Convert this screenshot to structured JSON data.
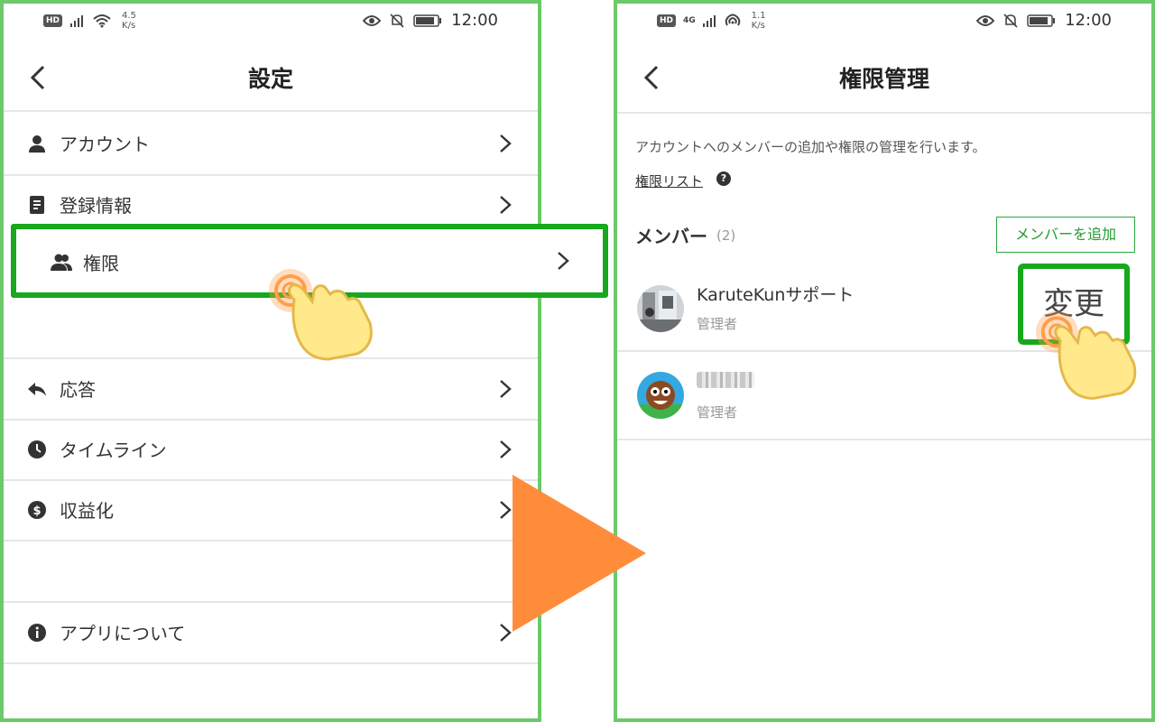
{
  "status_bar": {
    "left": {
      "hd": "HD",
      "network": "4G",
      "speed_left": "4.5",
      "speed_unit": "K/s",
      "speed_right": "1.1"
    },
    "time": "12:00"
  },
  "left_screen": {
    "title": "設定",
    "menu": [
      {
        "label": "アカウント",
        "icon": "person-icon"
      },
      {
        "label": "登録情報",
        "icon": "document-icon"
      },
      {
        "label": "権限",
        "icon": "people-icon"
      },
      {
        "label": "応答",
        "icon": "reply-icon"
      },
      {
        "label": "タイムライン",
        "icon": "clock-icon"
      },
      {
        "label": "収益化",
        "icon": "dollar-icon"
      },
      {
        "label": "アプリについて",
        "icon": "info-icon"
      }
    ]
  },
  "right_screen": {
    "title": "権限管理",
    "description": "アカウントへのメンバーの追加や権限の管理を行います。",
    "permission_list_link": "権限リスト",
    "help_glyph": "?",
    "members_heading": "メンバー",
    "members_count": "(2)",
    "add_member_button": "メンバーを追加",
    "members": [
      {
        "name": "KaruteKunサポート",
        "role": "管理者"
      },
      {
        "name": "",
        "role": "管理者"
      }
    ],
    "change_button": "変更"
  },
  "colors": {
    "frame_border": "#6cc96a",
    "highlight_green": "#17a81d",
    "arrow_orange": "#ff8c3b",
    "hand_yellow": "#ffe98a"
  }
}
